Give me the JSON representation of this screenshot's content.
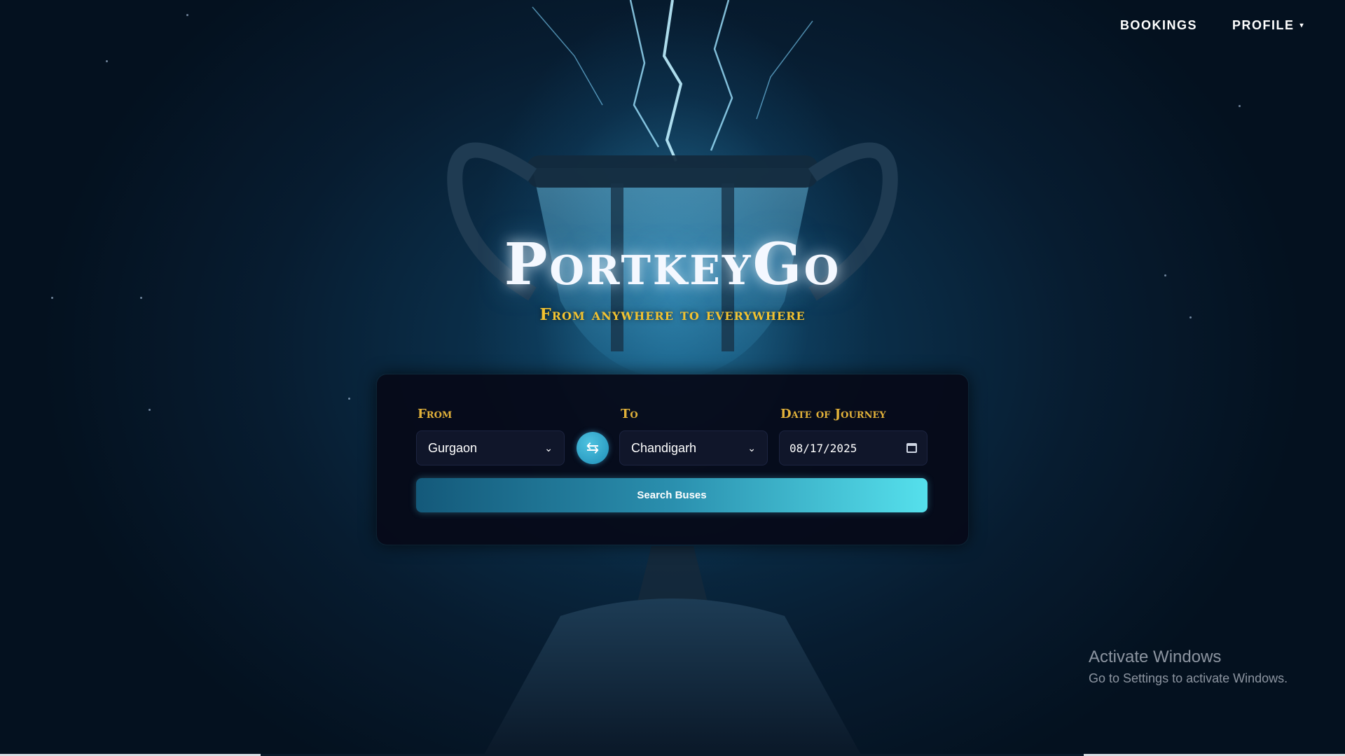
{
  "nav": {
    "bookings_label": "BOOKINGS",
    "profile_label": "PROFILE",
    "profile_caret": "▾"
  },
  "brand": {
    "title": "PortkeyGo",
    "tagline": "From anywhere to everywhere"
  },
  "search_form": {
    "from_label": "From",
    "from_value": "Gurgaon",
    "to_label": "To",
    "to_value": "Chandigarh",
    "date_label": "Date of Journey",
    "date_value": "08/17/2025",
    "swap_icon": "⇆",
    "search_button_label": "Search Buses"
  },
  "os_watermark": {
    "title": "Activate Windows",
    "subtitle": "Go to Settings to activate Windows."
  },
  "colors": {
    "accent_gold": "#e2b23a",
    "button_start": "#14597a",
    "button_end": "#55e0ec",
    "panel_bg": "#060a18"
  },
  "icons": {
    "select_chevron": "chevron-down-icon",
    "swap": "swap-arrows-icon",
    "date": "calendar-icon"
  }
}
